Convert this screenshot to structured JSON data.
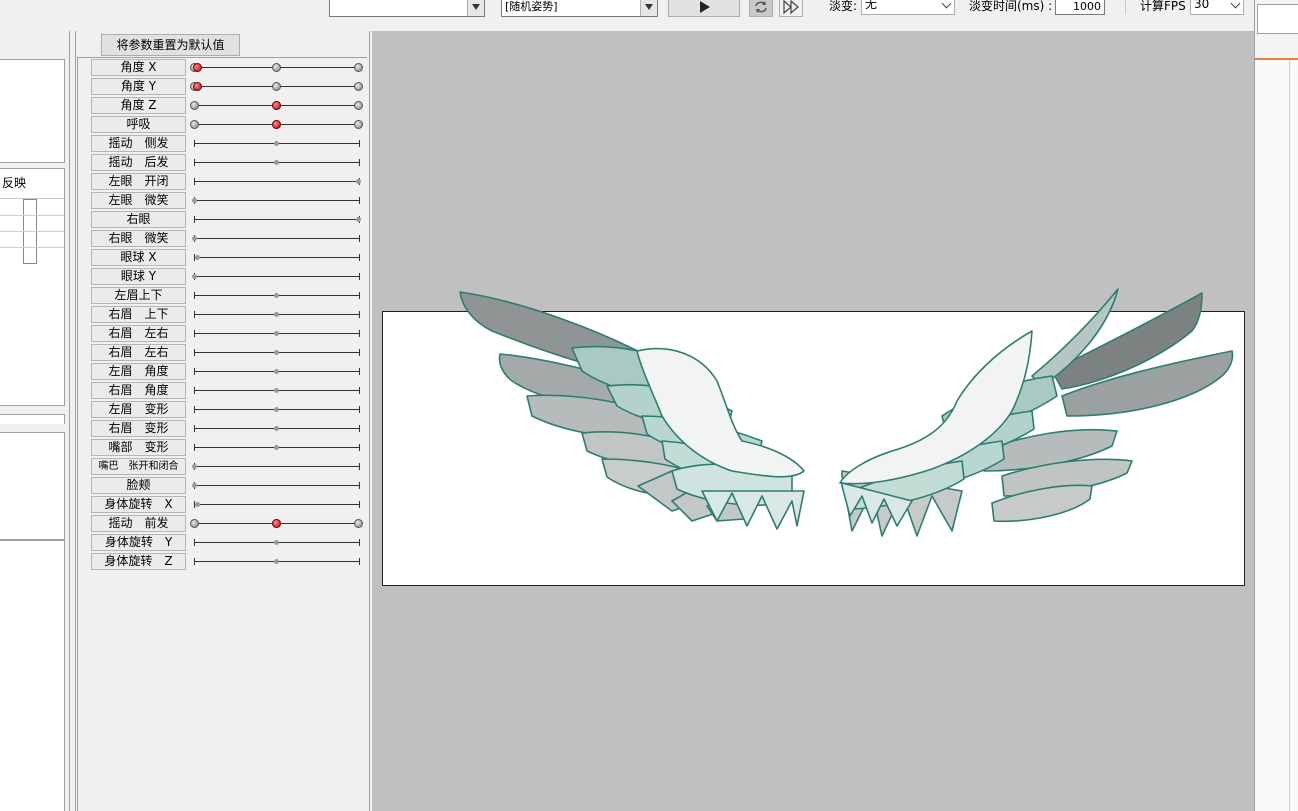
{
  "toolbar": {
    "motion_combo_value": "",
    "pose_combo_value": "[随机姿势]",
    "fade_label": "淡变:",
    "fade_value": "无",
    "fade_time_label": "淡变时间(ms) :",
    "fade_time_value": "1000",
    "fps_label": "计算FPS",
    "fps_value": "30"
  },
  "left_panel": {
    "column_header": "反映"
  },
  "param_panel": {
    "reset_button": "将参数重置为默认值",
    "params": [
      {
        "label": "角度 X",
        "value": 0.0
      },
      {
        "label": "角度 Y",
        "value": 0.0
      },
      {
        "label": "角度 Z",
        "value": 0.5
      },
      {
        "label": "呼吸",
        "value": 0.5
      },
      {
        "label": "摇动　侧发",
        "value": 0.5
      },
      {
        "label": "摇动　后发",
        "value": 0.5
      },
      {
        "label": "左眼　开闭",
        "value": 1.0
      },
      {
        "label": "左眼　微笑",
        "value": 0.0
      },
      {
        "label": "右眼",
        "value": 1.0
      },
      {
        "label": "右眼　微笑",
        "value": 0.0
      },
      {
        "label": "眼球 X",
        "value": 0.02
      },
      {
        "label": "眼球 Y",
        "value": 0.0
      },
      {
        "label": "左眉上下",
        "value": 0.5
      },
      {
        "label": "右眉　上下",
        "value": 0.5
      },
      {
        "label": "右眉　左右",
        "value": 0.5
      },
      {
        "label": "右眉　左右",
        "value": 0.5
      },
      {
        "label": "左眉　角度",
        "value": 0.5
      },
      {
        "label": "右眉　角度",
        "value": 0.5
      },
      {
        "label": "左眉　变形",
        "value": 0.5
      },
      {
        "label": "右眉　变形",
        "value": 0.5
      },
      {
        "label": "嘴部　变形",
        "value": 0.5
      },
      {
        "label": "嘴巴　张开和闭合",
        "value": 0.0
      },
      {
        "label": "脸颊",
        "value": 0.0
      },
      {
        "label": "身体旋转　X",
        "value": 0.02
      },
      {
        "label": "摇动　前发",
        "value": 0.5
      },
      {
        "label": "身体旋转　Y",
        "value": 0.5
      },
      {
        "label": "身体旋转　Z",
        "value": 0.5
      }
    ]
  },
  "colors": {
    "active_knob": "#c00000",
    "canvas_bg": "#c0c0c0",
    "wing_outline": "#2e7d72",
    "accent_line": "#e67d3c"
  }
}
